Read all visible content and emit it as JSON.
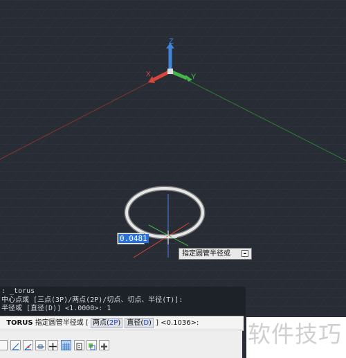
{
  "viewport": {
    "axis_labels": {
      "z": "Z",
      "y": "Y",
      "x": "X"
    },
    "dynamic_input_value": "0.0481",
    "tooltip_text": "指定圆管半径或"
  },
  "command_history": [
    ": _torus",
    "中心点或 [三点(3P)/两点(2P)/切点、切点、半径(T)]:",
    "半径或 [直径(D)] <1.0000>: 1"
  ],
  "command_line": {
    "command": "TORUS",
    "prompt": "指定圆管半径或",
    "open_bracket": "[",
    "option1_text": "两点(",
    "option1_key": "2P",
    "option1_close": ")",
    "option2_text": "直径(",
    "option2_key": "D",
    "option2_close": ")",
    "close_bracket": "]",
    "default_value": "<0.1036>:"
  },
  "watermark": "软件技巧",
  "colors": {
    "background": "#282c35",
    "axis_x": "#d9443b",
    "axis_y": "#45b649",
    "axis_z": "#3f86d8",
    "torus": "#e6e6e6",
    "selection": "#2a72d8"
  }
}
